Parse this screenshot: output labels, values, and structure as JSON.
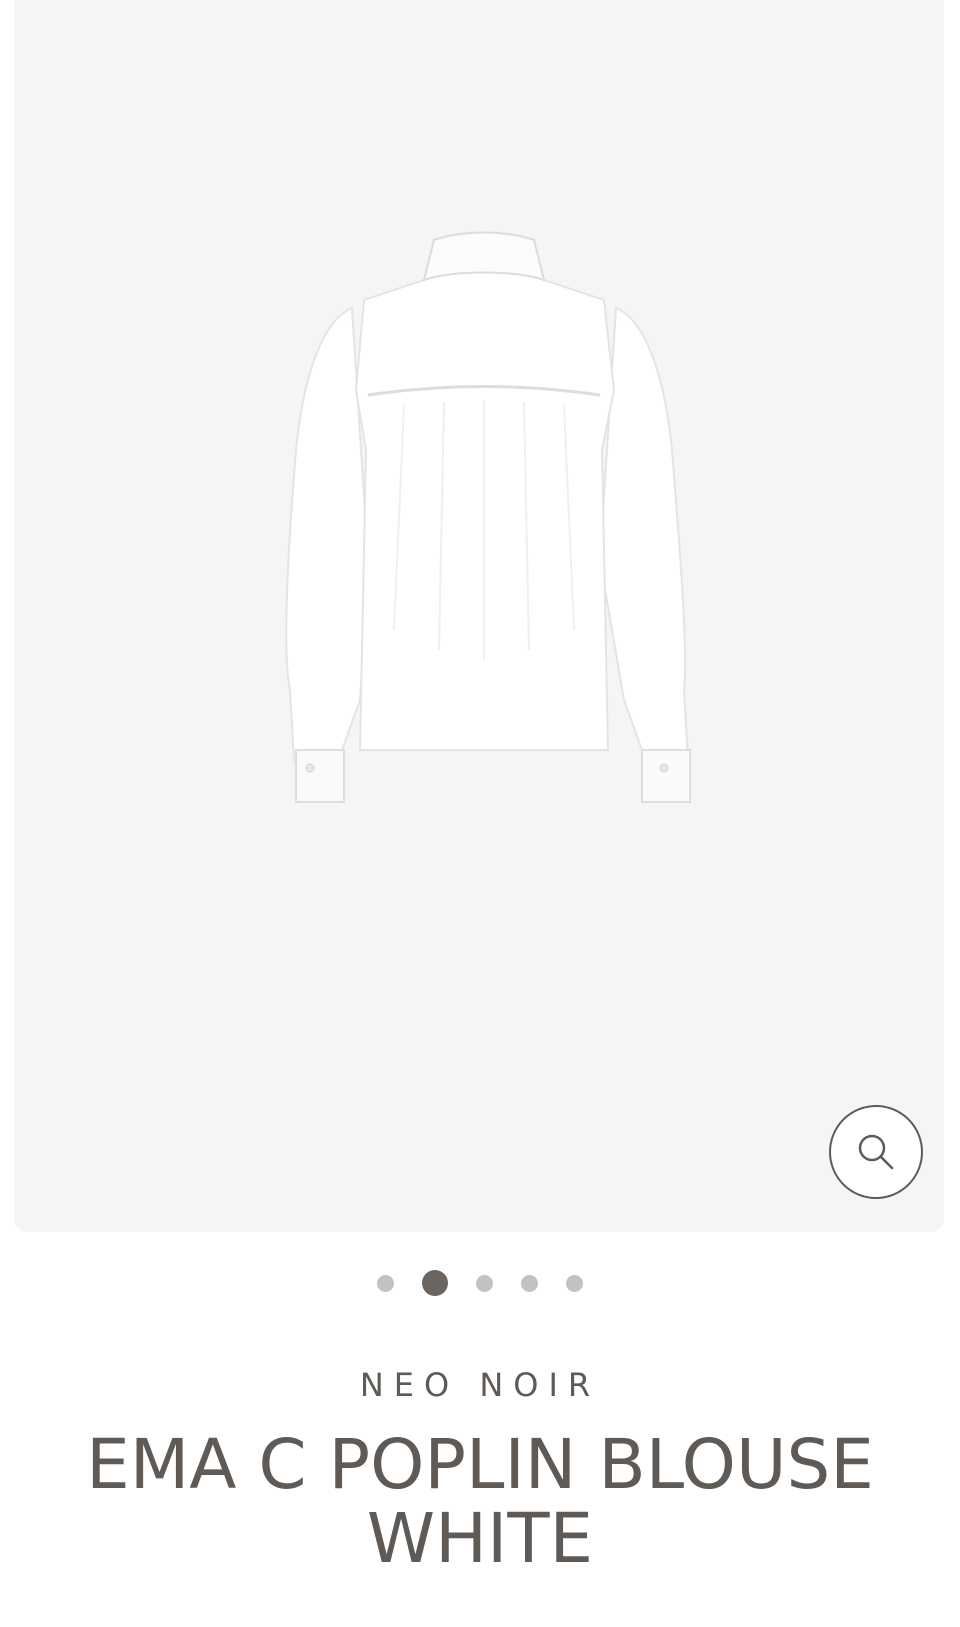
{
  "product": {
    "brand": "NEO NOIR",
    "title_line1": "EMA C POPLIN BLOUSE",
    "title_line2": "WHITE"
  },
  "gallery": {
    "image_icon": "blouse-back-view",
    "zoom_icon": "magnifier-icon",
    "slide_count": 5,
    "active_slide": 2
  },
  "colors": {
    "text": "#5f5a56",
    "gallery_bg": "#f5f5f5",
    "dot_inactive": "#c2c2c2",
    "dot_active": "#6a6561"
  }
}
